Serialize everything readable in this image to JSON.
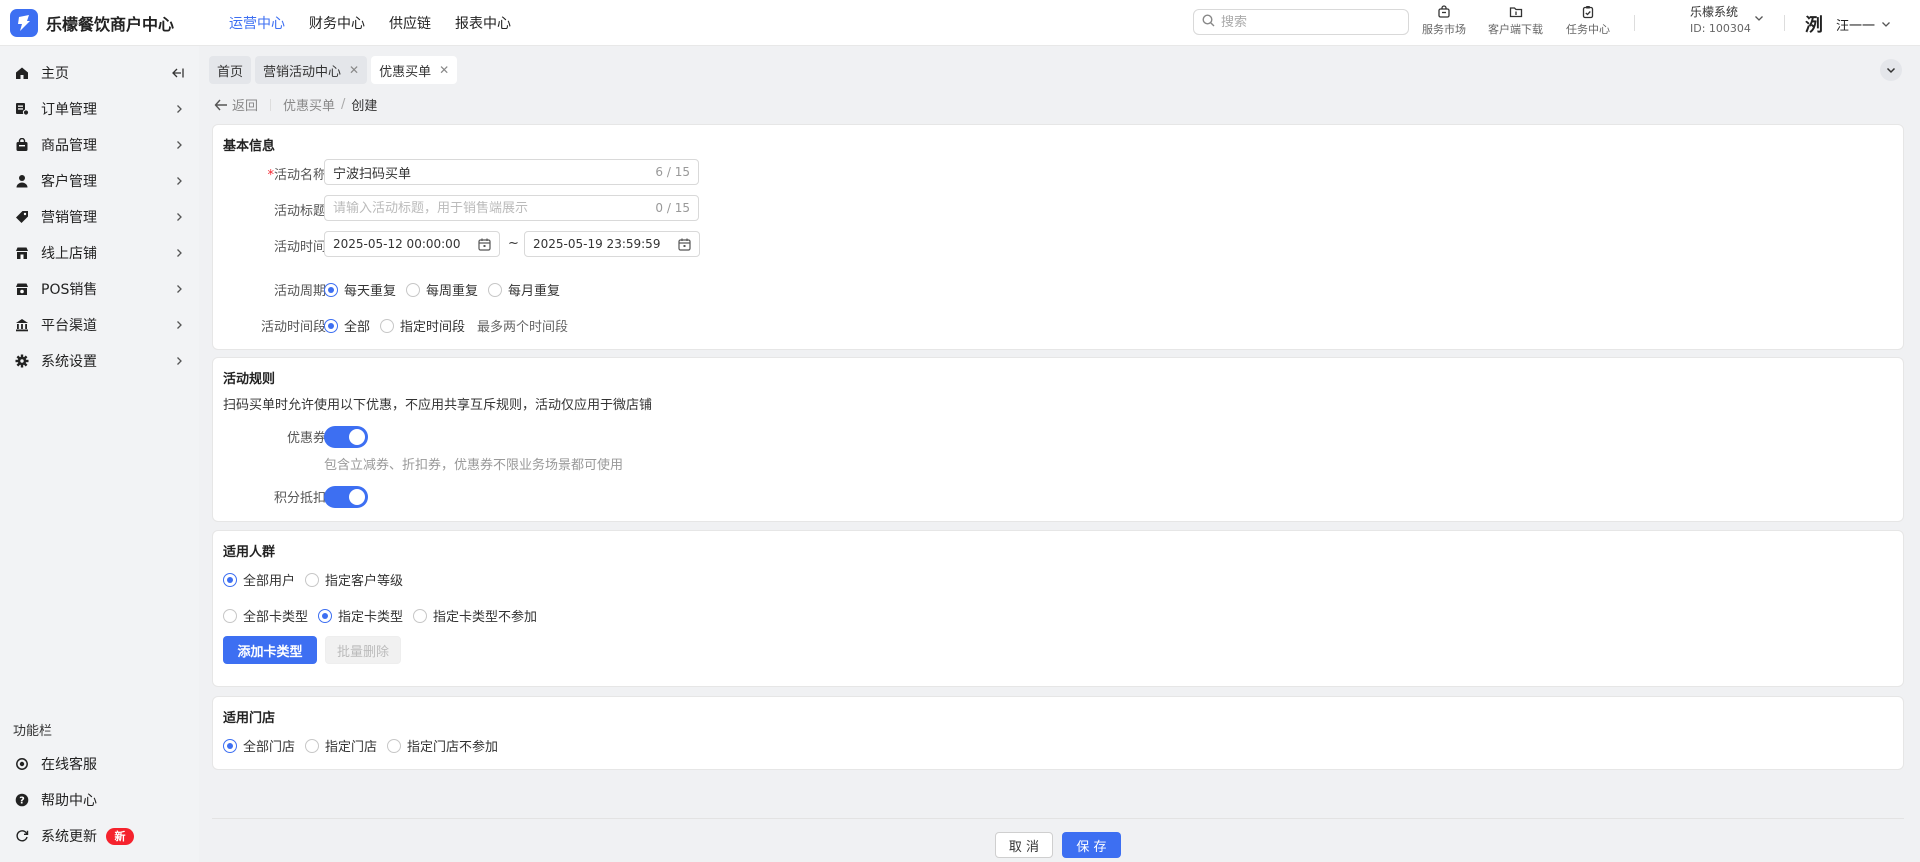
{
  "app": {
    "title": "乐檬餐饮商户中心",
    "logo_char": "乐"
  },
  "topnav": [
    "运营中心",
    "财务中心",
    "供应链",
    "报表中心"
  ],
  "search": {
    "placeholder": "搜索"
  },
  "tools": {
    "market": "服务市场",
    "download": "客户端下载",
    "tasks": "任务中心"
  },
  "system": {
    "name": "乐檬系统",
    "id": "ID: 100304"
  },
  "user": {
    "avatar": "洌",
    "name": "汪一一"
  },
  "sidebar": {
    "items": [
      {
        "label": "主页",
        "icon": "home-icon"
      },
      {
        "label": "订单管理",
        "icon": "order-icon"
      },
      {
        "label": "商品管理",
        "icon": "goods-icon"
      },
      {
        "label": "客户管理",
        "icon": "user-icon"
      },
      {
        "label": "营销管理",
        "icon": "tag-icon"
      },
      {
        "label": "线上店铺",
        "icon": "store-icon"
      },
      {
        "label": "POS销售",
        "icon": "pos-icon"
      },
      {
        "label": "平台渠道",
        "icon": "bank-icon"
      },
      {
        "label": "系统设置",
        "icon": "gear-icon"
      }
    ],
    "func_title": "功能栏",
    "func_items": [
      {
        "label": "在线客服",
        "icon": "headset-icon"
      },
      {
        "label": "帮助中心",
        "icon": "help-icon"
      },
      {
        "label": "系统更新",
        "icon": "refresh-icon",
        "badge": "新"
      }
    ]
  },
  "tabs": [
    {
      "label": "首页"
    },
    {
      "label": "营销活动中心"
    },
    {
      "label": "优惠买单"
    }
  ],
  "breadcrumb": {
    "back": "返回",
    "parent": "优惠买单",
    "current": "创建"
  },
  "basic": {
    "title": "基本信息",
    "name_label": "活动名称",
    "name_value": "宁波扫码买单",
    "name_count": "6 / 15",
    "title_label": "活动标题",
    "title_placeholder": "请输入活动标题，用于销售端展示",
    "title_count": "0 / 15",
    "time_label": "活动时间",
    "start_time": "2025-05-12 00:00:00",
    "tilde": "~",
    "end_time": "2025-05-19 23:59:59",
    "cycle_label": "活动周期",
    "cycle_options": [
      "每天重复",
      "每周重复",
      "每月重复"
    ],
    "period_label": "活动时间段",
    "period_options": [
      "全部",
      "指定时间段"
    ],
    "period_hint": "最多两个时间段"
  },
  "rules": {
    "title": "活动规则",
    "desc": "扫码买单时允许使用以下优惠，不应用共享互斥规则，活动仅应用于微店铺",
    "coupon_label": "优惠券",
    "coupon_desc": "包含立减券、折扣券，优惠券不限业务场景都可使用",
    "points_label": "积分抵扣"
  },
  "crowd": {
    "title": "适用人群",
    "user_options": [
      "全部用户",
      "指定客户等级"
    ],
    "card_options": [
      "全部卡类型",
      "指定卡类型",
      "指定卡类型不参加"
    ],
    "add_btn": "添加卡类型",
    "batch_delete": "批量删除"
  },
  "stores": {
    "title": "适用门店",
    "options": [
      "全部门店",
      "指定门店",
      "指定门店不参加"
    ]
  },
  "footer": {
    "cancel": "取 消",
    "save": "保 存"
  },
  "colors": {
    "primary": "#3d6ff2",
    "danger": "#f5222d"
  }
}
